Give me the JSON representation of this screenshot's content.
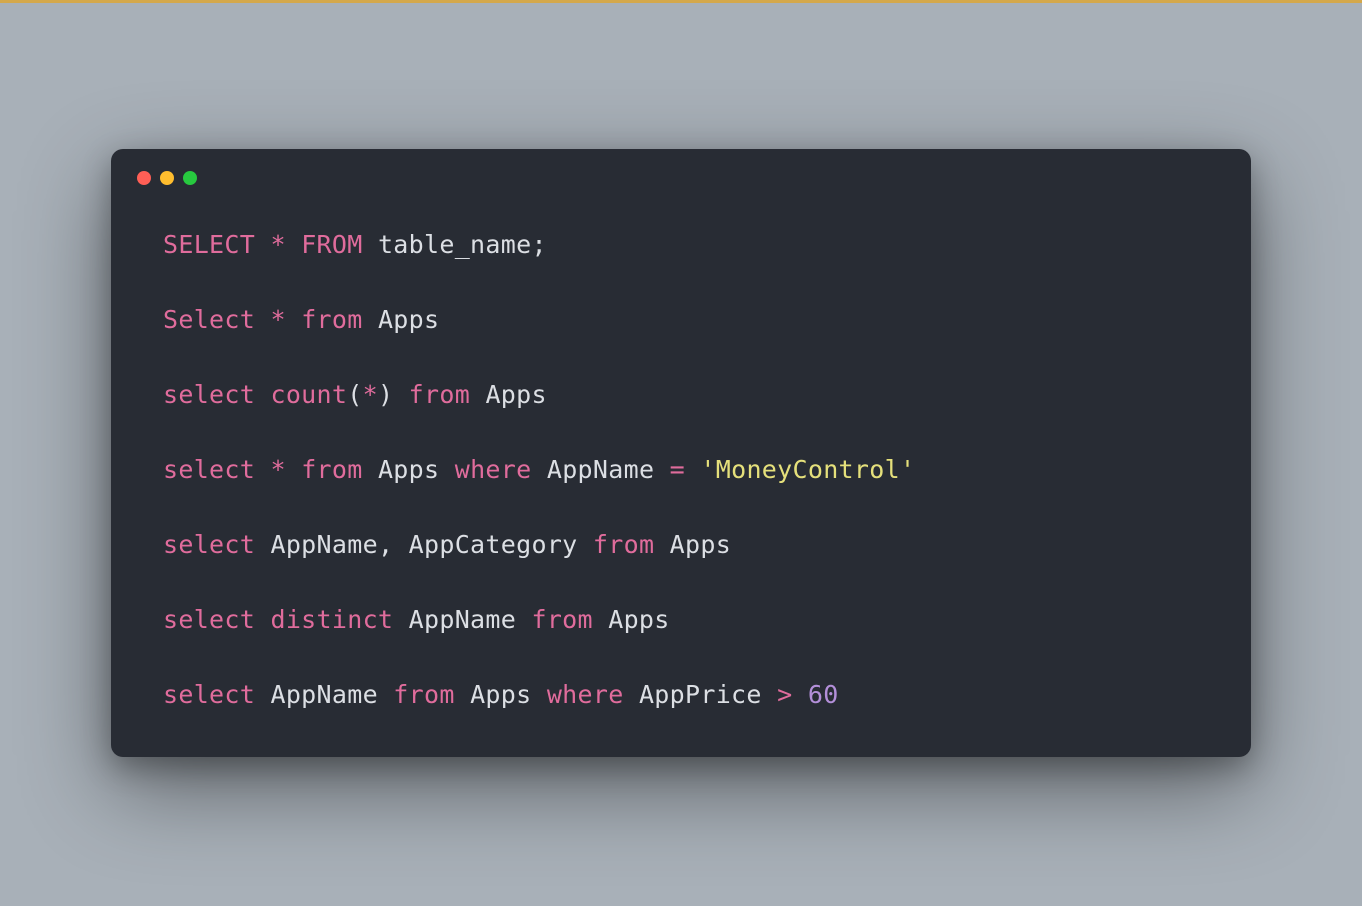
{
  "window": {
    "traffic_lights": {
      "red": "#ff5f56",
      "yellow": "#ffbd2e",
      "green": "#27c93f"
    }
  },
  "code": {
    "lines": [
      [
        {
          "t": "SELECT",
          "c": "kw"
        },
        {
          "t": " ",
          "c": "sp"
        },
        {
          "t": "*",
          "c": "op"
        },
        {
          "t": " ",
          "c": "sp"
        },
        {
          "t": "FROM",
          "c": "kw"
        },
        {
          "t": " ",
          "c": "sp"
        },
        {
          "t": "table_name",
          "c": "ident"
        },
        {
          "t": ";",
          "c": "punct"
        }
      ],
      [
        {
          "t": "Select",
          "c": "kw"
        },
        {
          "t": " ",
          "c": "sp"
        },
        {
          "t": "*",
          "c": "op"
        },
        {
          "t": " ",
          "c": "sp"
        },
        {
          "t": "from",
          "c": "kw"
        },
        {
          "t": " ",
          "c": "sp"
        },
        {
          "t": "Apps",
          "c": "ident"
        }
      ],
      [
        {
          "t": "select",
          "c": "kw"
        },
        {
          "t": " ",
          "c": "sp"
        },
        {
          "t": "count",
          "c": "func"
        },
        {
          "t": "(",
          "c": "punct"
        },
        {
          "t": "*",
          "c": "op"
        },
        {
          "t": ")",
          "c": "punct"
        },
        {
          "t": " ",
          "c": "sp"
        },
        {
          "t": "from",
          "c": "kw"
        },
        {
          "t": " ",
          "c": "sp"
        },
        {
          "t": "Apps",
          "c": "ident"
        }
      ],
      [
        {
          "t": "select",
          "c": "kw"
        },
        {
          "t": " ",
          "c": "sp"
        },
        {
          "t": "*",
          "c": "op"
        },
        {
          "t": " ",
          "c": "sp"
        },
        {
          "t": "from",
          "c": "kw"
        },
        {
          "t": " ",
          "c": "sp"
        },
        {
          "t": "Apps",
          "c": "ident"
        },
        {
          "t": " ",
          "c": "sp"
        },
        {
          "t": "where",
          "c": "kw"
        },
        {
          "t": " ",
          "c": "sp"
        },
        {
          "t": "AppName",
          "c": "ident"
        },
        {
          "t": " ",
          "c": "sp"
        },
        {
          "t": "=",
          "c": "op"
        },
        {
          "t": " ",
          "c": "sp"
        },
        {
          "t": "'MoneyControl'",
          "c": "str"
        }
      ],
      [
        {
          "t": "select",
          "c": "kw"
        },
        {
          "t": " ",
          "c": "sp"
        },
        {
          "t": "AppName",
          "c": "ident"
        },
        {
          "t": ",",
          "c": "punct"
        },
        {
          "t": " ",
          "c": "sp"
        },
        {
          "t": "AppCategory",
          "c": "ident"
        },
        {
          "t": " ",
          "c": "sp"
        },
        {
          "t": "from",
          "c": "kw"
        },
        {
          "t": " ",
          "c": "sp"
        },
        {
          "t": "Apps",
          "c": "ident"
        }
      ],
      [
        {
          "t": "select",
          "c": "kw"
        },
        {
          "t": " ",
          "c": "sp"
        },
        {
          "t": "distinct",
          "c": "kw"
        },
        {
          "t": " ",
          "c": "sp"
        },
        {
          "t": "AppName",
          "c": "ident"
        },
        {
          "t": " ",
          "c": "sp"
        },
        {
          "t": "from",
          "c": "kw"
        },
        {
          "t": " ",
          "c": "sp"
        },
        {
          "t": "Apps",
          "c": "ident"
        }
      ],
      [
        {
          "t": "select",
          "c": "kw"
        },
        {
          "t": " ",
          "c": "sp"
        },
        {
          "t": "AppName",
          "c": "ident"
        },
        {
          "t": " ",
          "c": "sp"
        },
        {
          "t": "from",
          "c": "kw"
        },
        {
          "t": " ",
          "c": "sp"
        },
        {
          "t": "Apps",
          "c": "ident"
        },
        {
          "t": " ",
          "c": "sp"
        },
        {
          "t": "where",
          "c": "kw"
        },
        {
          "t": " ",
          "c": "sp"
        },
        {
          "t": "AppPrice",
          "c": "ident"
        },
        {
          "t": " ",
          "c": "sp"
        },
        {
          "t": ">",
          "c": "op"
        },
        {
          "t": " ",
          "c": "sp"
        },
        {
          "t": "60",
          "c": "num"
        }
      ]
    ]
  }
}
